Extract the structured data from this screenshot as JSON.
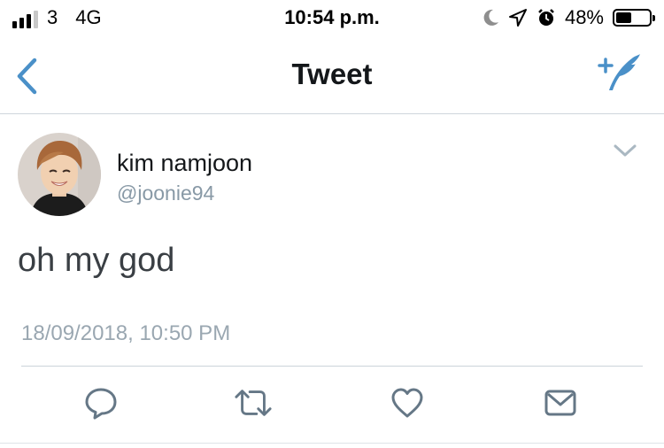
{
  "status_bar": {
    "signal_bars_filled": 3,
    "signal_bars_total": 4,
    "carrier": "3",
    "network": "4G",
    "time": "10:54 p.m.",
    "battery_percent": "48%",
    "battery_level": 0.48,
    "icons": [
      "moon-icon",
      "location-arrow-icon",
      "alarm-icon"
    ]
  },
  "nav": {
    "title": "Tweet",
    "back_icon": "chevron-left-icon",
    "compose_icon": "compose-tweet-icon"
  },
  "tweet": {
    "display_name": "kim namjoon",
    "handle": "@joonie94",
    "text": "oh my god",
    "timestamp": "18/09/2018, 10:50 PM"
  },
  "actions": [
    "reply-icon",
    "retweet-icon",
    "like-icon",
    "direct-message-icon"
  ],
  "colors": {
    "accent": "#4a90c8",
    "secondary_text": "#8899a6",
    "divider": "#ccd3d9",
    "icon_gray": "#657786"
  }
}
